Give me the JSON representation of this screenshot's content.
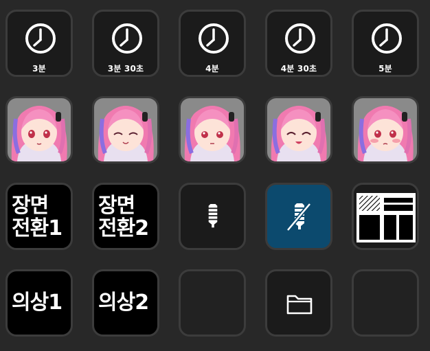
{
  "colors": {
    "background": "#282828",
    "key_border": "#3c3c3c",
    "key_dark": "#1b1b1b",
    "key_black": "#000000",
    "key_blue": "#0c4a6e",
    "icon_white": "#ffffff"
  },
  "row1": {
    "timers": [
      {
        "label": "3분",
        "icon": "clock-icon"
      },
      {
        "label": "3분 30초",
        "icon": "clock-icon"
      },
      {
        "label": "4분",
        "icon": "clock-icon"
      },
      {
        "label": "4분 30초",
        "icon": "clock-icon"
      },
      {
        "label": "5분",
        "icon": "clock-icon"
      }
    ]
  },
  "row2": {
    "avatars": [
      {
        "expression": "neutral"
      },
      {
        "expression": "smile-closed-eyes"
      },
      {
        "expression": "neutral"
      },
      {
        "expression": "smile-closed-eyes"
      },
      {
        "expression": "blush"
      }
    ]
  },
  "row3": {
    "scene1": {
      "line1": "장면",
      "line2": "전환1"
    },
    "scene2": {
      "line1": "장면",
      "line2": "전환2"
    },
    "mic_on": {
      "icon": "microphone-icon"
    },
    "mic_off": {
      "icon": "microphone-muted-icon"
    },
    "layout": {
      "icon": "layout-grid-icon"
    }
  },
  "row4": {
    "outfit1": {
      "label": "의상1"
    },
    "outfit2": {
      "label": "의상2"
    },
    "empty1": {},
    "folder": {
      "icon": "folder-icon"
    },
    "empty2": {}
  }
}
